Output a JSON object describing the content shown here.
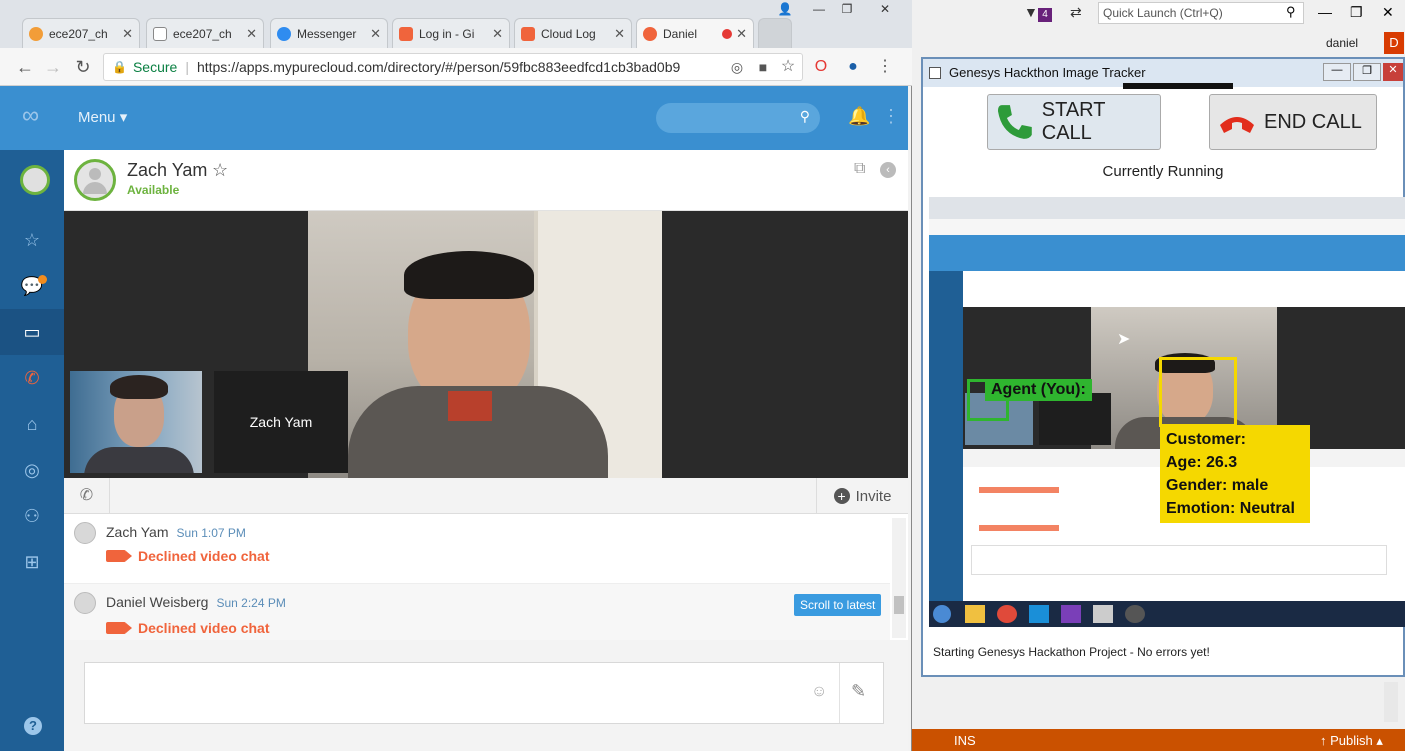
{
  "browser": {
    "tabs": [
      {
        "label": "ece207_ch",
        "icon": "ece-icon",
        "color": "#f29d38"
      },
      {
        "label": "ece207_ch",
        "icon": "doc-icon",
        "color": "#e0e0e0"
      },
      {
        "label": "Messenger",
        "icon": "messenger-icon",
        "color": "#2f8cf0"
      },
      {
        "label": "Log in - Gi",
        "icon": "gitlab-icon",
        "color": "#f0643c"
      },
      {
        "label": "Cloud Log",
        "icon": "cloud-icon",
        "color": "#f0643c"
      },
      {
        "label": "Daniel",
        "icon": "genesys-icon",
        "color": "#f0643c"
      }
    ],
    "secure_label": "Secure",
    "url": "https://apps.mypurecloud.com/directory/#/person/59fbc883eedfcd1cb3bad0b9",
    "profile_name": "daniel"
  },
  "app": {
    "menu_label": "Menu",
    "contact_name": "Zach Yam",
    "contact_status": "Available",
    "remote_tile_label": "Zach Yam",
    "invite_label": "Invite",
    "scroll_label": "Scroll to latest",
    "messages": [
      {
        "sender": "Zach Yam",
        "time": "Sun 1:07 PM",
        "text": "Declined video chat"
      },
      {
        "sender": "Daniel Weisberg",
        "time": "Sun 2:24 PM",
        "text": "Declined video chat"
      }
    ]
  },
  "vs": {
    "quick_launch": "Quick Launch (Ctrl+Q)",
    "notif_count": "4",
    "user": "daniel",
    "user_initial": "D",
    "status_ins": "INS",
    "publish_label": "Publish"
  },
  "tracker": {
    "title": "Genesys Hackthon Image Tracker",
    "start_label": "START CALL",
    "end_label": "END CALL",
    "running_label": "Currently Running",
    "agent_label": "Agent (You):",
    "customer_lines": [
      "Customer:",
      "Age: 26.3",
      "Gender: male",
      "Emotion: Neutral"
    ],
    "log_text": "Starting Genesys Hackathon Project - No errors yet!"
  },
  "colors": {
    "header_blue": "#3a8fd0",
    "nav_blue": "#1f5f95",
    "declined_orange": "#f0643c",
    "available_green": "#6db33f",
    "annotation_yellow": "#f5d800",
    "annotation_green": "#2fb52f"
  }
}
